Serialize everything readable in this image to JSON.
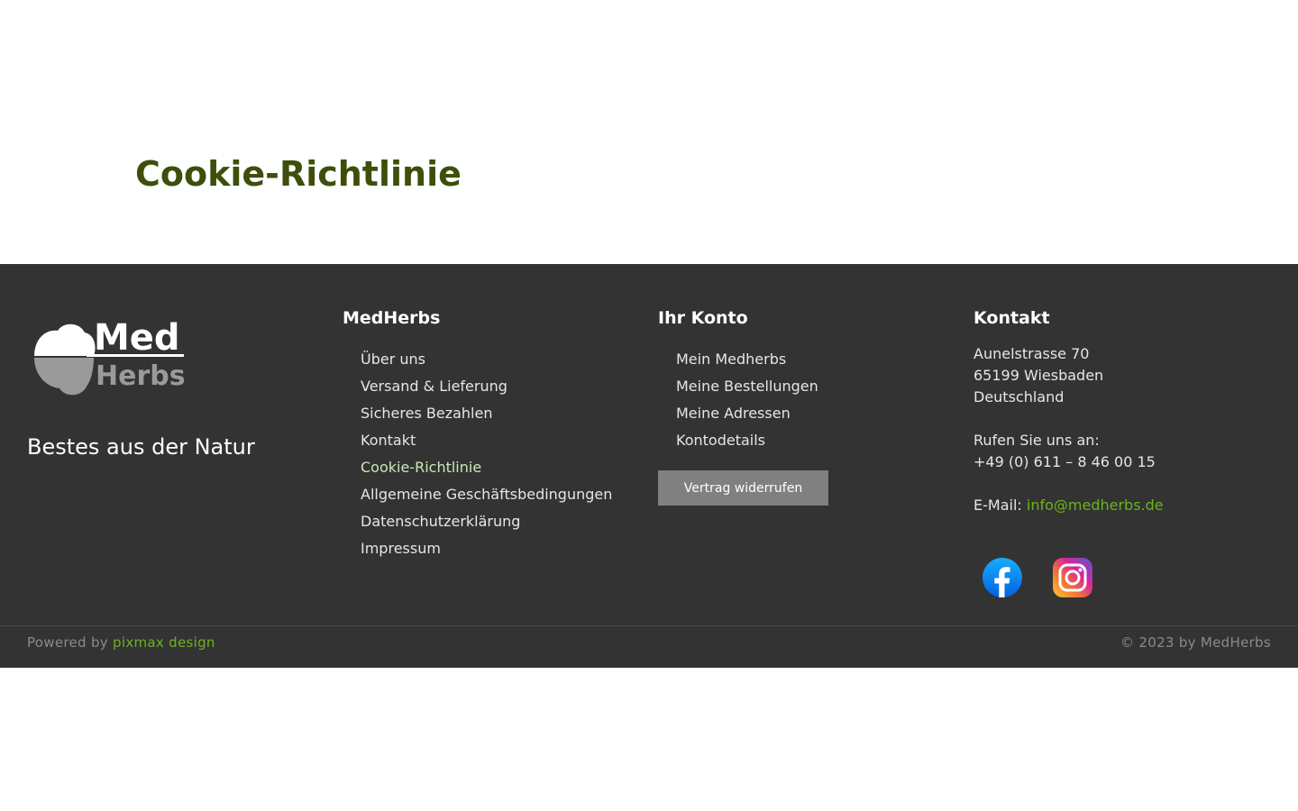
{
  "page": {
    "title": "Cookie-Richtlinie"
  },
  "brand": {
    "logo_word_1": "Med",
    "logo_word_2": "Herbs",
    "tagline": "Bestes aus der Natur"
  },
  "footer": {
    "medherbs": {
      "heading": "MedHerbs",
      "links": [
        "Über uns",
        "Versand & Lieferung",
        "Sicheres Bezahlen",
        "Kontakt",
        "Cookie-Richtlinie",
        "Allgemeine Geschäftsbedingungen",
        "Datenschutzerklärung",
        "Impressum"
      ]
    },
    "konto": {
      "heading": "Ihr Konto",
      "links": [
        "Mein Medherbs",
        "Meine Bestellungen",
        "Meine Adressen",
        "Kontodetails"
      ],
      "revoke_button": "Vertrag widerrufen"
    },
    "kontakt": {
      "heading": "Kontakt",
      "street": "Aunelstrasse 70",
      "city": "65199 Wiesbaden",
      "country": "Deutschland",
      "phone_label": "Rufen Sie uns an:",
      "phone": "+49 (0) 611 – 8 46 00 15",
      "email_label": "E-Mail:",
      "email": "info@medherbs.de"
    },
    "social": [
      "facebook-icon",
      "instagram-icon"
    ]
  },
  "bottom": {
    "powered_label": "Powered by",
    "powered_link": "pixmax design",
    "copyright": "© 2023 by MedHerbs"
  },
  "colors": {
    "title": "#3d4f0b",
    "footer_bg": "#333333",
    "accent": "#6bb31d",
    "active_link": "#c9e8b6",
    "button_bg": "#808080"
  }
}
